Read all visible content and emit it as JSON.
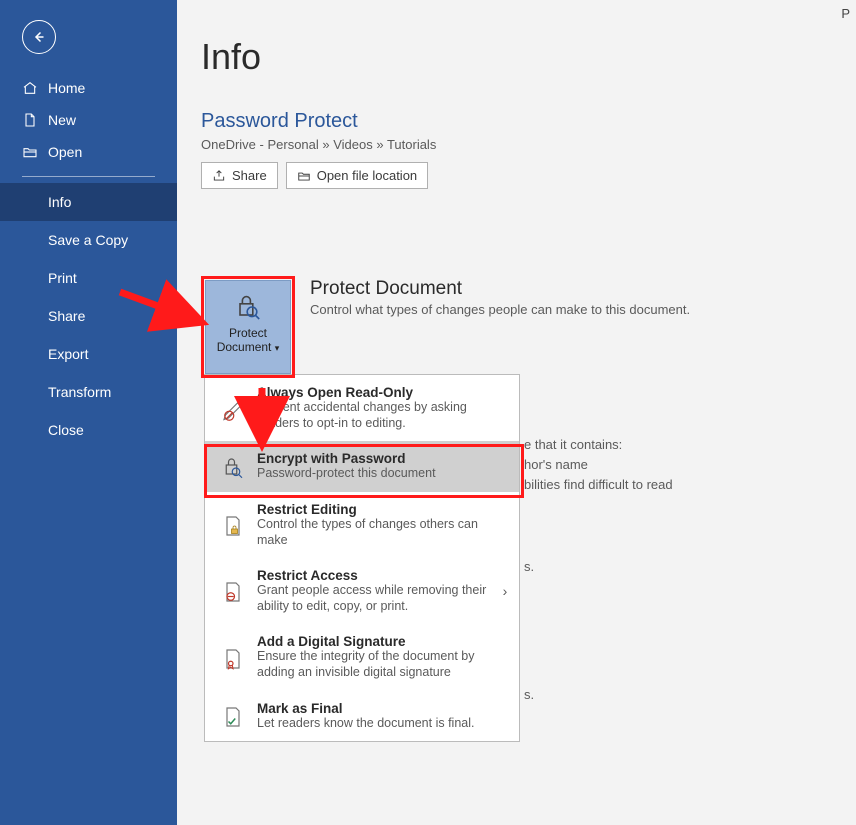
{
  "topright_initial": "P",
  "sidebar": {
    "items_top": [
      {
        "label": "Home"
      },
      {
        "label": "New"
      },
      {
        "label": "Open"
      }
    ],
    "items_bottom": [
      {
        "label": "Info"
      },
      {
        "label": "Save a Copy"
      },
      {
        "label": "Print"
      },
      {
        "label": "Share"
      },
      {
        "label": "Export"
      },
      {
        "label": "Transform"
      },
      {
        "label": "Close"
      }
    ]
  },
  "page": {
    "title": "Info",
    "doc_title": "Password Protect",
    "breadcrumb": "OneDrive - Personal » Videos » Tutorials",
    "share_btn": "Share",
    "openloc_btn": "Open file location"
  },
  "protect": {
    "btn_line1": "Protect",
    "btn_line2": "Document",
    "header": "Protect Document",
    "sub": "Control what types of changes people can make to this document."
  },
  "menu": [
    {
      "title": "Always Open Read-Only",
      "desc": "Prevent accidental changes by asking readers to opt-in to editing.",
      "sub": false
    },
    {
      "title": "Encrypt with Password",
      "desc": "Password-protect this document",
      "sub": false
    },
    {
      "title": "Restrict Editing",
      "desc": "Control the types of changes others can make",
      "sub": false
    },
    {
      "title": "Restrict Access",
      "desc": "Grant people access while removing their ability to edit, copy, or print.",
      "sub": true
    },
    {
      "title": "Add a Digital Signature",
      "desc": "Ensure the integrity of the document by adding an invisible digital signature",
      "sub": false
    },
    {
      "title": "Mark as Final",
      "desc": "Let readers know the document is final.",
      "sub": false
    }
  ],
  "bg": {
    "f1": "e that it contains:",
    "f2": "hor's name",
    "f3": "bilities find difficult to read",
    "f4": "s.",
    "f5": "s."
  },
  "icons": {
    "back": "back-arrow",
    "home": "home",
    "new": "file",
    "open": "folder-open",
    "share": "share",
    "loc": "folder-open",
    "lock": "lock-magnify"
  }
}
